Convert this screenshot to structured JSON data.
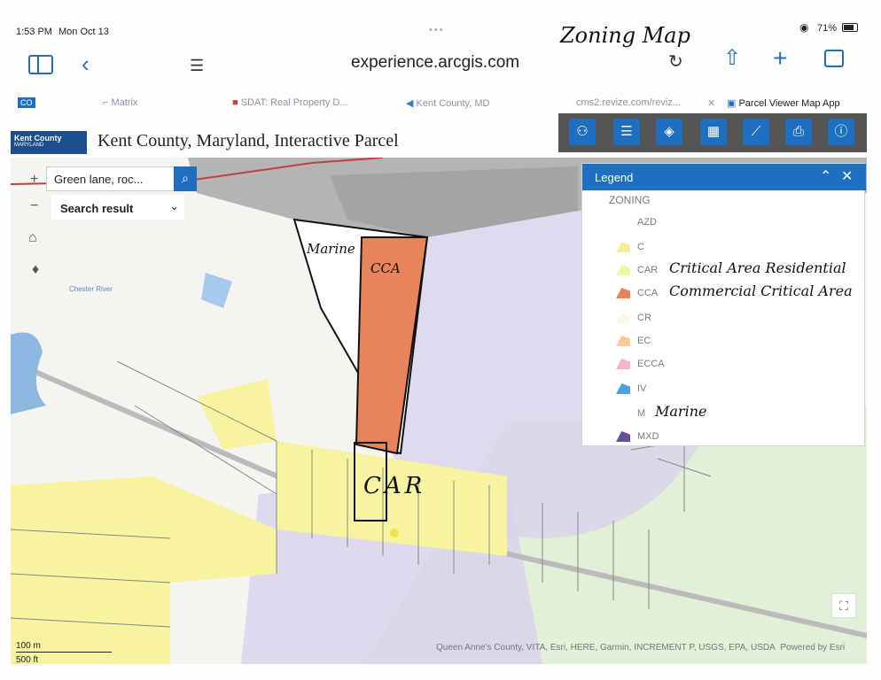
{
  "status": {
    "time": "1:53 PM",
    "date": "Mon Oct 13",
    "battery": "71%"
  },
  "handwritten_title": "Zoning Map",
  "browser": {
    "url": "experience.arcgis.com"
  },
  "tabs": [
    {
      "label": "CO"
    },
    {
      "label": "Matrix"
    },
    {
      "label": "SDAT: Real Property D..."
    },
    {
      "label": "Kent County, MD"
    },
    {
      "label": "cms2.revize.com/reviz..."
    },
    {
      "label": "Parcel Viewer Map App"
    }
  ],
  "app": {
    "logo_text": "Kent County",
    "logo_sub": "MARYLAND",
    "title": "Kent County, Maryland, Interactive Parcel"
  },
  "search": {
    "value": "Green lane, roc...",
    "result_label": "Search result"
  },
  "legend": {
    "title": "Legend",
    "section": "ZONING",
    "items": [
      {
        "code": "AZD",
        "color": "#ffffff",
        "note": ""
      },
      {
        "code": "C",
        "color": "#f6ec9a",
        "note": ""
      },
      {
        "code": "CAR",
        "color": "#f7f4a0",
        "note": "Critical Area Residential"
      },
      {
        "code": "CCA",
        "color": "#e8845a",
        "note": "Commercial Critical Area"
      },
      {
        "code": "CR",
        "color": "#fbf6e6",
        "note": ""
      },
      {
        "code": "EC",
        "color": "#f6c99a",
        "note": ""
      },
      {
        "code": "ECCA",
        "color": "#f4b3c9",
        "note": ""
      },
      {
        "code": "IV",
        "color": "#4aa3df",
        "note": ""
      },
      {
        "code": "M",
        "color": "#ffffff",
        "note": "Marine"
      },
      {
        "code": "MXD",
        "color": "#6a4d9a",
        "note": ""
      }
    ]
  },
  "map_labels": {
    "chester_river": "Chester River",
    "marine": "Marine",
    "cca": "CCA",
    "car": "CAR"
  },
  "scale": {
    "metric": "100 m",
    "imperial": "500 ft"
  },
  "attribution": "Queen Anne's County, VITA, Esri, HERE, Garmin, INCREMENT P, USGS, EPA, USDA",
  "powered_by": "Powered by Esri"
}
